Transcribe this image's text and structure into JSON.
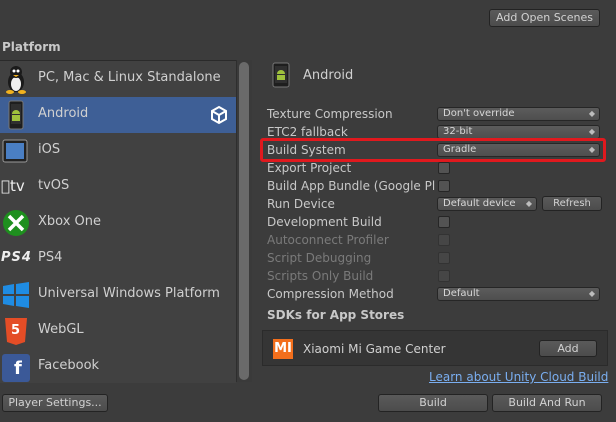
{
  "top": {
    "add_open_scenes": "Add Open Scenes"
  },
  "platform": {
    "header": "Platform",
    "items": [
      {
        "label": "PC, Mac & Linux Standalone",
        "icon": "linux-penguin-icon"
      },
      {
        "label": "Android",
        "icon": "android-icon",
        "selected": true,
        "badge": "unity-icon"
      },
      {
        "label": "iOS",
        "icon": "ipad-icon"
      },
      {
        "label": "tvOS",
        "icon": "apple-tv-icon",
        "icon_text": "tv"
      },
      {
        "label": "Xbox One",
        "icon": "xbox-icon"
      },
      {
        "label": "PS4",
        "icon": "ps4-icon",
        "icon_text": "PS4"
      },
      {
        "label": "Universal Windows Platform",
        "icon": "windows-icon"
      },
      {
        "label": "WebGL",
        "icon": "html5-icon",
        "icon_text": "5"
      },
      {
        "label": "Facebook",
        "icon": "facebook-icon",
        "icon_text": "f"
      }
    ]
  },
  "settings": {
    "title": "Android",
    "texture_compression": {
      "label": "Texture Compression",
      "value": "Don't override"
    },
    "etc2_fallback": {
      "label": "ETC2 fallback",
      "value": "32-bit"
    },
    "build_system": {
      "label": "Build System",
      "value": "Gradle"
    },
    "export_project": {
      "label": "Export Project"
    },
    "build_app_bundle": {
      "label": "Build App Bundle (Google Pla"
    },
    "run_device": {
      "label": "Run Device",
      "value": "Default device",
      "refresh": "Refresh"
    },
    "development_build": {
      "label": "Development Build"
    },
    "autoconnect_profiler": {
      "label": "Autoconnect Profiler"
    },
    "script_debugging": {
      "label": "Script Debugging"
    },
    "scripts_only_build": {
      "label": "Scripts Only Build"
    },
    "compression_method": {
      "label": "Compression Method",
      "value": "Default"
    }
  },
  "sdks": {
    "header": "SDKs for App Stores",
    "items": [
      {
        "name": "Xiaomi Mi Game Center",
        "logo": "mi",
        "add_label": "Add"
      }
    ],
    "learn_link": "Learn about Unity Cloud Build"
  },
  "bottom": {
    "player_settings": "Player Settings...",
    "build": "Build",
    "build_and_run": "Build And Run"
  },
  "colors": {
    "selection": "#3e5f96",
    "highlight": "#e0191e",
    "link": "#7aaef0"
  }
}
